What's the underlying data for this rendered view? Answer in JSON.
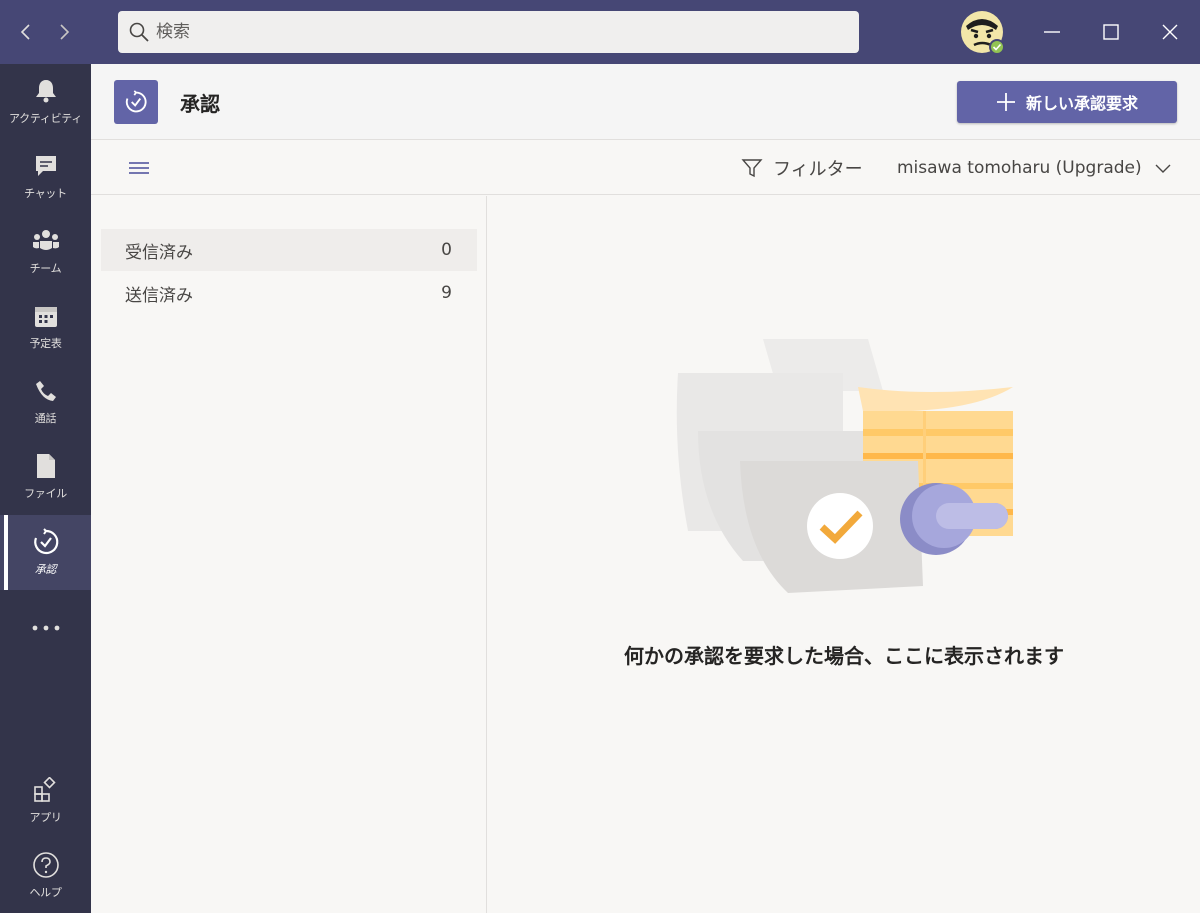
{
  "search": {
    "placeholder": "検索"
  },
  "rail": {
    "items": [
      {
        "label": "アクティビティ"
      },
      {
        "label": "チャット"
      },
      {
        "label": "チーム"
      },
      {
        "label": "予定表"
      },
      {
        "label": "通話"
      },
      {
        "label": "ファイル"
      },
      {
        "label": "承認"
      }
    ],
    "bottom": [
      {
        "label": "アプリ"
      },
      {
        "label": "ヘルプ"
      }
    ]
  },
  "header": {
    "title": "承認",
    "new_button": "新しい承認要求"
  },
  "toolbar": {
    "filter_label": "フィルター",
    "account_label": "misawa tomoharu (Upgrade)"
  },
  "list": {
    "items": [
      {
        "label": "受信済み",
        "count": "0"
      },
      {
        "label": "送信済み",
        "count": "9"
      }
    ]
  },
  "empty_state": {
    "message": "何かの承認を要求した場合、ここに表示されます"
  },
  "colors": {
    "titlebar": "#464775",
    "rail": "#33344a",
    "accent": "#6264a7"
  }
}
